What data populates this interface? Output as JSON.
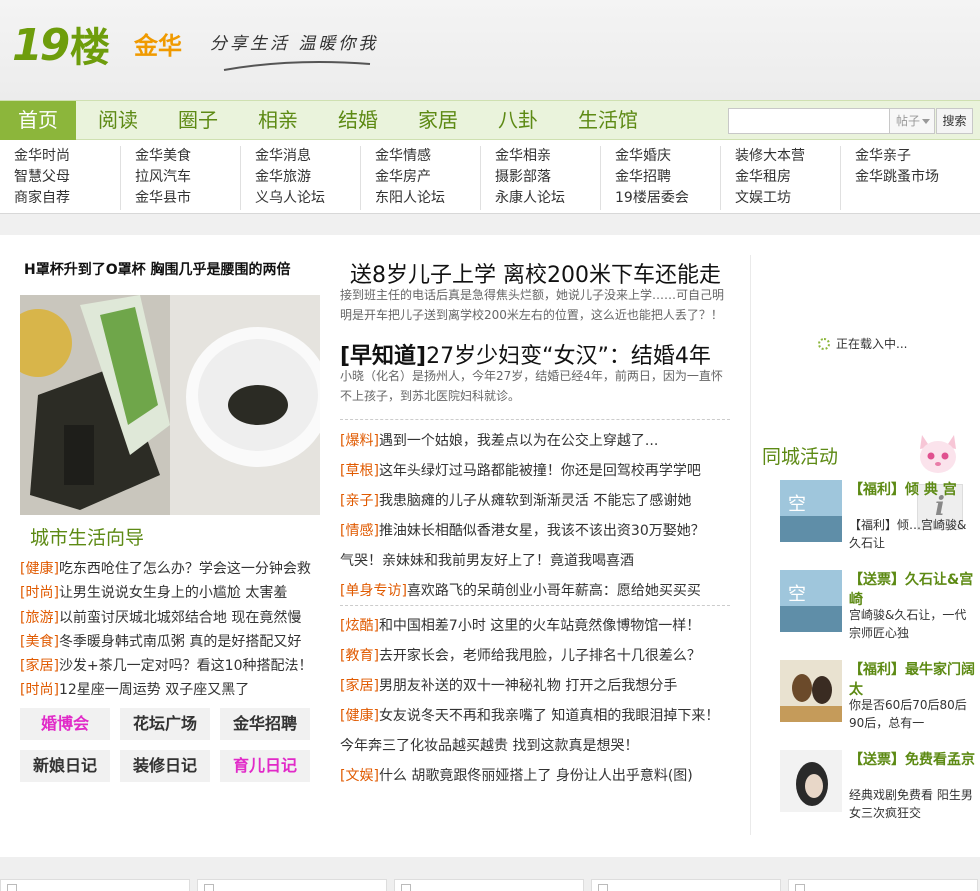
{
  "brand": {
    "logo_num": "19",
    "logo_char": "楼",
    "city": "金华",
    "slogan": "分享生活 温暖你我"
  },
  "nav": {
    "items": [
      "首页",
      "阅读",
      "圈子",
      "相亲",
      "结婚",
      "家居",
      "八卦",
      "生活馆"
    ],
    "active": "首页",
    "search_placeholder": "",
    "search_select": "帖子",
    "search_button": "搜索"
  },
  "subnav": [
    [
      "金华时尚",
      "智慧父母",
      "商家自荐"
    ],
    [
      "金华美食",
      "拉风汽车",
      "金华县市"
    ],
    [
      "金华消息",
      "金华旅游",
      "义乌人论坛"
    ],
    [
      "金华情感",
      "金华房产",
      "东阳人论坛"
    ],
    [
      "金华相亲",
      "摄影部落",
      "永康人论坛"
    ],
    [
      "金华婚庆",
      "金华招聘",
      "19楼居委会"
    ],
    [
      "装修大本营",
      "金华租房",
      "文娱工坊"
    ],
    [
      "金华亲子",
      "金华跳蚤市场"
    ]
  ],
  "left": {
    "top_title": "H罩杯升到了O罩杯 胸围几乎是腰围的两倍",
    "guide_heading": "城市生活向导",
    "guide_items": [
      {
        "tag": "[健康]",
        "text": "吃东西呛住了怎么办？学会这一分钟会救"
      },
      {
        "tag": "[时尚]",
        "text": "让男生说说女生身上的小尴尬 太害羞"
      },
      {
        "tag": "[旅游]",
        "text": "以前蛮讨厌城北城郊结合地 现在竟然慢"
      },
      {
        "tag": "[美食]",
        "text": "冬季暖身韩式南瓜粥 真的是好搭配又好"
      },
      {
        "tag": "[家居]",
        "text": "沙发+茶几一定对吗？看这10种搭配法！"
      },
      {
        "tag": "[时尚]",
        "text": "12星座一周运势 双子座又黑了"
      }
    ],
    "quick_buttons": [
      "婚博会",
      "花坛广场",
      "金华招聘",
      "新娘日记",
      "装修日记",
      "育儿日记"
    ]
  },
  "middle": {
    "headline1": "送8岁儿子上学 离校200米下车还能走",
    "summary1_line1": "接到班主任的电话后真是急得焦头烂额，她说儿子没来上学……可自己明",
    "summary1_line2": "明是开车把儿子送到离学校200米左右的位置，这么近也能把人丢了？！",
    "headline2_tag": "[早知道]",
    "headline2_text": "27岁少妇变“女汉”：结婚4年",
    "summary2_line1": "小晓（化名）是扬州人，今年27岁，结婚已经4年，前两日，因为一直怀",
    "summary2_line2": "不上孩子，到苏北医院妇科就诊。",
    "news_group1": [
      {
        "tag": "[爆料]",
        "text": "遇到一个姑娘，我差点以为在公交上穿越了..."
      },
      {
        "tag": "[草根]",
        "text": "这年头绿灯过马路都能被撞！你还是回驾校再学学吧"
      },
      {
        "tag": "[亲子]",
        "text": "我患脑瘫的儿子从瘫软到渐渐灵活 不能忘了感谢她"
      },
      {
        "tag": "[情感]",
        "text": "推油妹长相酷似香港女星，我该不该出资30万娶她？"
      },
      {
        "tag": "",
        "text": "气哭！亲妹妹和我前男友好上了！竟道我喝喜酒"
      },
      {
        "tag": "[单身专访]",
        "text": "喜欢路飞的呆萌创业小哥年薪高：愿给她买买买"
      }
    ],
    "news_group2": [
      {
        "tag": "[炫酷]",
        "text": "和中国相差7小时 这里的火车站竟然像博物馆一样！"
      },
      {
        "tag": "[教育]",
        "text": "去开家长会，老师给我甩脸，儿子排名十几很差么？"
      },
      {
        "tag": "[家居]",
        "text": "男朋友补送的双十一神秘礼物 打开之后我想分手"
      },
      {
        "tag": "[健康]",
        "text": "女友说冬天不再和我亲嘴了 知道真相的我眼泪掉下来！"
      },
      {
        "tag": "",
        "text": "今年奔三了化妆品越买越贵 找到这款真是想哭！"
      },
      {
        "tag": "[文娱]",
        "text": "什么 胡歌竟跟佟丽娅搭上了 身份让人出乎意料(图)"
      }
    ]
  },
  "right": {
    "loading_text": "正在载入中...",
    "activity_heading": "同城活动",
    "info_glyph": "i",
    "activities": [
      {
        "title": "【福利】倾 典 宫",
        "desc": "【福利】倾…宫崎骏&久石让",
        "thumb_text": "空"
      },
      {
        "title": "【送票】久石让&宫崎",
        "desc": "宫崎骏&久石让，一代宗师匠心独",
        "thumb_text": "空"
      },
      {
        "title": "【福利】最牛家门阔太",
        "desc": "你是否60后70后80后90后，总有一"
      },
      {
        "title": "【送票】免费看孟京",
        "desc": "经典戏剧免费看 阳生男女三次疯狂交"
      }
    ]
  },
  "colors": {
    "brand_green": "#5d8a14",
    "nav_active": "#8cb63b",
    "tag_orange": "#e05a00",
    "logo_orange": "#f09a00",
    "pink": "#e12ac8"
  }
}
